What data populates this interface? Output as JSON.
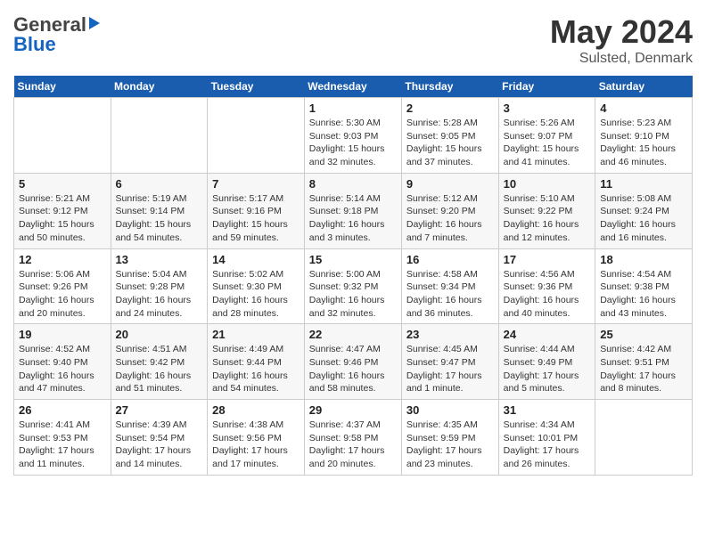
{
  "header": {
    "logo_general": "General",
    "logo_blue": "Blue",
    "title": "May 2024",
    "location": "Sulsted, Denmark"
  },
  "calendar": {
    "weekdays": [
      "Sunday",
      "Monday",
      "Tuesday",
      "Wednesday",
      "Thursday",
      "Friday",
      "Saturday"
    ],
    "weeks": [
      [
        {
          "day": "",
          "info": ""
        },
        {
          "day": "",
          "info": ""
        },
        {
          "day": "",
          "info": ""
        },
        {
          "day": "1",
          "info": "Sunrise: 5:30 AM\nSunset: 9:03 PM\nDaylight: 15 hours\nand 32 minutes."
        },
        {
          "day": "2",
          "info": "Sunrise: 5:28 AM\nSunset: 9:05 PM\nDaylight: 15 hours\nand 37 minutes."
        },
        {
          "day": "3",
          "info": "Sunrise: 5:26 AM\nSunset: 9:07 PM\nDaylight: 15 hours\nand 41 minutes."
        },
        {
          "day": "4",
          "info": "Sunrise: 5:23 AM\nSunset: 9:10 PM\nDaylight: 15 hours\nand 46 minutes."
        }
      ],
      [
        {
          "day": "5",
          "info": "Sunrise: 5:21 AM\nSunset: 9:12 PM\nDaylight: 15 hours\nand 50 minutes."
        },
        {
          "day": "6",
          "info": "Sunrise: 5:19 AM\nSunset: 9:14 PM\nDaylight: 15 hours\nand 54 minutes."
        },
        {
          "day": "7",
          "info": "Sunrise: 5:17 AM\nSunset: 9:16 PM\nDaylight: 15 hours\nand 59 minutes."
        },
        {
          "day": "8",
          "info": "Sunrise: 5:14 AM\nSunset: 9:18 PM\nDaylight: 16 hours\nand 3 minutes."
        },
        {
          "day": "9",
          "info": "Sunrise: 5:12 AM\nSunset: 9:20 PM\nDaylight: 16 hours\nand 7 minutes."
        },
        {
          "day": "10",
          "info": "Sunrise: 5:10 AM\nSunset: 9:22 PM\nDaylight: 16 hours\nand 12 minutes."
        },
        {
          "day": "11",
          "info": "Sunrise: 5:08 AM\nSunset: 9:24 PM\nDaylight: 16 hours\nand 16 minutes."
        }
      ],
      [
        {
          "day": "12",
          "info": "Sunrise: 5:06 AM\nSunset: 9:26 PM\nDaylight: 16 hours\nand 20 minutes."
        },
        {
          "day": "13",
          "info": "Sunrise: 5:04 AM\nSunset: 9:28 PM\nDaylight: 16 hours\nand 24 minutes."
        },
        {
          "day": "14",
          "info": "Sunrise: 5:02 AM\nSunset: 9:30 PM\nDaylight: 16 hours\nand 28 minutes."
        },
        {
          "day": "15",
          "info": "Sunrise: 5:00 AM\nSunset: 9:32 PM\nDaylight: 16 hours\nand 32 minutes."
        },
        {
          "day": "16",
          "info": "Sunrise: 4:58 AM\nSunset: 9:34 PM\nDaylight: 16 hours\nand 36 minutes."
        },
        {
          "day": "17",
          "info": "Sunrise: 4:56 AM\nSunset: 9:36 PM\nDaylight: 16 hours\nand 40 minutes."
        },
        {
          "day": "18",
          "info": "Sunrise: 4:54 AM\nSunset: 9:38 PM\nDaylight: 16 hours\nand 43 minutes."
        }
      ],
      [
        {
          "day": "19",
          "info": "Sunrise: 4:52 AM\nSunset: 9:40 PM\nDaylight: 16 hours\nand 47 minutes."
        },
        {
          "day": "20",
          "info": "Sunrise: 4:51 AM\nSunset: 9:42 PM\nDaylight: 16 hours\nand 51 minutes."
        },
        {
          "day": "21",
          "info": "Sunrise: 4:49 AM\nSunset: 9:44 PM\nDaylight: 16 hours\nand 54 minutes."
        },
        {
          "day": "22",
          "info": "Sunrise: 4:47 AM\nSunset: 9:46 PM\nDaylight: 16 hours\nand 58 minutes."
        },
        {
          "day": "23",
          "info": "Sunrise: 4:45 AM\nSunset: 9:47 PM\nDaylight: 17 hours\nand 1 minute."
        },
        {
          "day": "24",
          "info": "Sunrise: 4:44 AM\nSunset: 9:49 PM\nDaylight: 17 hours\nand 5 minutes."
        },
        {
          "day": "25",
          "info": "Sunrise: 4:42 AM\nSunset: 9:51 PM\nDaylight: 17 hours\nand 8 minutes."
        }
      ],
      [
        {
          "day": "26",
          "info": "Sunrise: 4:41 AM\nSunset: 9:53 PM\nDaylight: 17 hours\nand 11 minutes."
        },
        {
          "day": "27",
          "info": "Sunrise: 4:39 AM\nSunset: 9:54 PM\nDaylight: 17 hours\nand 14 minutes."
        },
        {
          "day": "28",
          "info": "Sunrise: 4:38 AM\nSunset: 9:56 PM\nDaylight: 17 hours\nand 17 minutes."
        },
        {
          "day": "29",
          "info": "Sunrise: 4:37 AM\nSunset: 9:58 PM\nDaylight: 17 hours\nand 20 minutes."
        },
        {
          "day": "30",
          "info": "Sunrise: 4:35 AM\nSunset: 9:59 PM\nDaylight: 17 hours\nand 23 minutes."
        },
        {
          "day": "31",
          "info": "Sunrise: 4:34 AM\nSunset: 10:01 PM\nDaylight: 17 hours\nand 26 minutes."
        },
        {
          "day": "",
          "info": ""
        }
      ]
    ]
  }
}
